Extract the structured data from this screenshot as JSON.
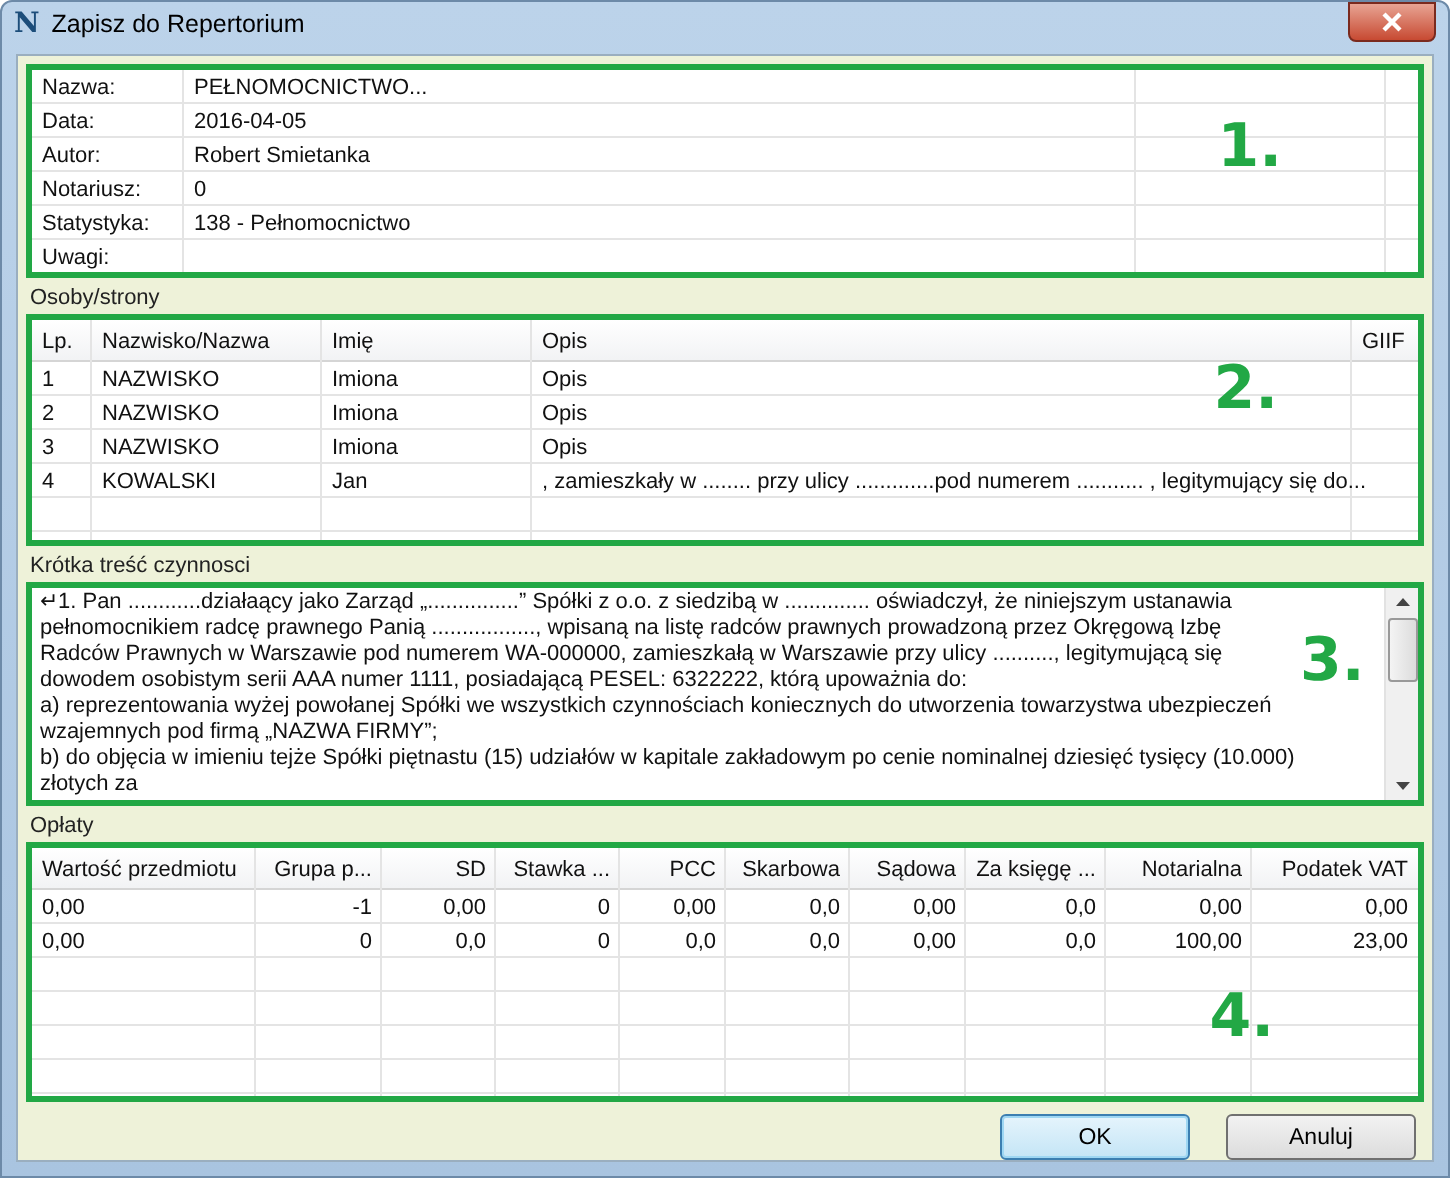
{
  "window": {
    "app_icon": "N",
    "title": "Zapisz do Repertorium"
  },
  "details": {
    "marker": "1.",
    "rows": [
      {
        "label": "Nazwa:",
        "value": "PEŁNOMOCNICTWO..."
      },
      {
        "label": "Data:",
        "value": "2016-04-05"
      },
      {
        "label": "Autor:",
        "value": "Robert Smietanka"
      },
      {
        "label": "Notariusz:",
        "value": "0"
      },
      {
        "label": "Statystyka:",
        "value": "138 - Pełnomocnictwo"
      },
      {
        "label": "Uwagi:"
      }
    ]
  },
  "persons": {
    "title": "Osoby/strony",
    "marker": "2.",
    "columns": [
      "Lp.",
      "Nazwisko/Nazwa",
      "Imię",
      "Opis",
      "GIIF"
    ],
    "rows": [
      [
        "1",
        "NAZWISKO",
        "Imiona",
        "Opis"
      ],
      [
        "2",
        "NAZWISKO",
        "Imiona",
        "Opis"
      ],
      [
        "3",
        "NAZWISKO",
        "Imiona",
        "Opis"
      ],
      [
        "4",
        "KOWALSKI",
        "Jan",
        ", zamieszkały w ........ przy ulicy .............pod numerem ........... , legitymujący się do..."
      ]
    ]
  },
  "summary": {
    "title": "Krótka treść czynnosci",
    "marker": "3.",
    "paragraphs": [
      "↵1. Pan ............działaący jako Zarząd „...............” Spółki z o.o. z siedzibą w .............. oświadczył, że niniejszym ustanawia pełnomocnikiem radcę prawnego Panią ................., wpisaną na listę radców prawnych prowadzoną przez Okręgową Izbę Radców Prawnych w Warszawie pod numerem WA-000000, zamieszkałą w Warszawie przy ulicy .........., legitymującą się dowodem osobistym serii AAA numer 1111, posiadającą PESEL: 6322222, którą upoważnia do:",
      "a) reprezentowania wyżej powołanej Spółki we wszystkich czynnościach koniecznych do utworzenia towarzystwa ubezpieczeń wzajemnych pod firmą „NAZWA FIRMY”;",
      "b) do objęcia w imieniu tejże Spółki piętnastu (15) udziałów w kapitale zakładowym po cenie nominalnej dziesięć tysięcy (10.000) złotych za"
    ]
  },
  "fees": {
    "title": "Opłaty",
    "marker": "4.",
    "columns": [
      "Wartość przedmiotu",
      "Grupa p...",
      "SD",
      "Stawka ...",
      "PCC",
      "Skarbowa",
      "Sądowa",
      "Za księgę ...",
      "Notarialna",
      "Podatek VAT"
    ],
    "rows": [
      [
        "0,00",
        "-1",
        "0,00",
        "0",
        "0,00",
        "0,0",
        "0,00",
        "0,0",
        "0,00",
        "0,00"
      ],
      [
        "0,00",
        "0",
        "0,0",
        "0",
        "0,0",
        "0,0",
        "0,00",
        "0,0",
        "100,00",
        "23,00"
      ]
    ]
  },
  "buttons": [
    {
      "label": "OK",
      "default": true
    },
    {
      "label": "Anuluj",
      "default": false
    }
  ]
}
